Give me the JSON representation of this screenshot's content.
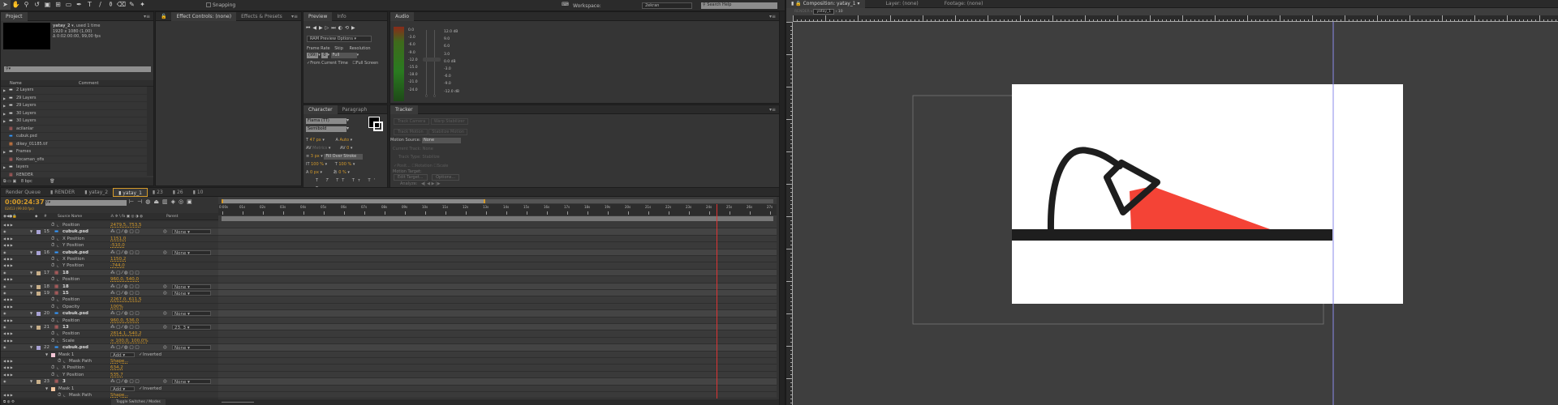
{
  "toolbar": {
    "snapping_label": "Snapping",
    "workspace_label": "Workspace:",
    "workspace_value": "2ekran",
    "search_placeholder": "Search Help"
  },
  "project": {
    "tab": "Project",
    "comp_name": "yatay_2",
    "used": ", used 1 time",
    "dims": "1920 x 1080 (1,00)",
    "duration": "Δ 0:02:00:00, 99,00 fps",
    "col_name": "Name",
    "col_comment": "Comment",
    "items": [
      {
        "type": "folder",
        "name": "2 Layers"
      },
      {
        "type": "folder",
        "name": "29 Layers"
      },
      {
        "type": "folder",
        "name": "29 Layers"
      },
      {
        "type": "folder",
        "name": "30 Layers"
      },
      {
        "type": "folder",
        "name": "30 Layers"
      },
      {
        "type": "comp",
        "name": "acilanlar"
      },
      {
        "type": "psd",
        "name": "cubuk.psd"
      },
      {
        "type": "tif",
        "name": "dikey_01185.tif"
      },
      {
        "type": "folder",
        "name": "Frames"
      },
      {
        "type": "comp",
        "name": "Kocaman_ofis"
      },
      {
        "type": "folder",
        "name": "layers"
      },
      {
        "type": "comp",
        "name": "RENDER"
      }
    ],
    "bpc": "8 bpc"
  },
  "effects": {
    "tab1": "Effect Controls: (none)",
    "tab2": "Effects & Presets"
  },
  "preview": {
    "tab1": "Preview",
    "tab2": "Info",
    "ram": "RAM Preview Options",
    "frame_rate_label": "Frame Rate",
    "skip_label": "Skip",
    "resolution_label": "Resolution",
    "frame_rate": "(99)",
    "skip": "0",
    "resolution": "Full",
    "from_current": "From Current Time",
    "full_screen": "Full Screen"
  },
  "audio": {
    "tab": "Audio",
    "meter_labels": [
      "0.0",
      "-3.0",
      "-6.0",
      "-9.0",
      "-12.0",
      "-15.0",
      "-18.0",
      "-21.0",
      "-24.0"
    ],
    "gain_labels": [
      "12.0 dB",
      "9.0",
      "6.0",
      "3.0",
      "0.0 dB",
      "-3.0",
      "-6.0",
      "-9.0",
      "-12.0 dB"
    ],
    "slider_l": "0",
    "slider_r": "0"
  },
  "character": {
    "tab1": "Character",
    "tab2": "Paragraph",
    "font": "Flama (TT)",
    "style": "Semibold",
    "size": "47 px",
    "leading": "Auto",
    "kerning": "Metrics",
    "tracking": "0",
    "stroke": "3 px",
    "stroke_mode": "Fill Over Stroke",
    "vscale": "100 %",
    "hscale": "100 %",
    "baseline": "0 px",
    "tsume": "0 %"
  },
  "tracker": {
    "tab": "Tracker",
    "track_camera": "Track Camera",
    "warp": "Warp Stabilizer",
    "track_motion": "Track Motion",
    "stabilize": "Stabilize Motion",
    "motion_source_label": "Motion Source:",
    "motion_source": "None",
    "current_track_label": "Current Track:",
    "current_track": "None",
    "track_type_label": "Track Type:",
    "track_type": "Stabilize",
    "position": "Posit...",
    "rotation": "Rotation",
    "scale": "Scale",
    "motion_target": "Motion Target:",
    "edit_target": "Edit Target...",
    "options": "Options...",
    "analyze": "Analyze:"
  },
  "timeline": {
    "tabs": [
      "Render Queue",
      "RENDER",
      "yatay_2",
      "yatay_1",
      "23",
      "26",
      "10"
    ],
    "active_tab": 3,
    "time": "0:00:24:37",
    "frame": "02413 (99.00 fps)",
    "col_source": "Source Name",
    "col_parent": "Parent",
    "ruler": [
      "0:00s",
      "01s",
      "02s",
      "03s",
      "04s",
      "05s",
      "06s",
      "07s",
      "08s",
      "09s",
      "10s",
      "11s",
      "12s",
      "13s",
      "14s",
      "15s",
      "16s",
      "17s",
      "18s",
      "19s",
      "20s",
      "21s",
      "22s",
      "23s",
      "24s",
      "25s",
      "26s",
      "27s"
    ],
    "current_seconds": 24.37,
    "work_area_end_seconds": 13,
    "toggle_label": "Toggle Switches / Modes",
    "rows": [
      {
        "k": "prop",
        "name": "Position",
        "value": "2479,5, 753,5"
      },
      {
        "k": "layer",
        "num": "15",
        "name": "cubuk.psd",
        "icon": "psd",
        "color": "#a9a3d6",
        "parent": "None"
      },
      {
        "k": "prop",
        "name": "X Position",
        "value": "1151,0"
      },
      {
        "k": "prop",
        "name": "Y Position",
        "value": "-510,0"
      },
      {
        "k": "layer",
        "num": "16",
        "name": "cubuk.psd",
        "icon": "psd",
        "color": "#a9a3d6",
        "parent": "None"
      },
      {
        "k": "prop",
        "name": "X Position",
        "value": "1150,2"
      },
      {
        "k": "prop",
        "name": "Y Position",
        "value": "-744,0"
      },
      {
        "k": "layer",
        "num": "17",
        "name": "18",
        "icon": "comp",
        "color": "#c9b08a",
        "parent": ""
      },
      {
        "k": "prop",
        "name": "Position",
        "value": "960,0, 540,0"
      },
      {
        "k": "layer",
        "num": "18",
        "name": "18",
        "icon": "comp",
        "color": "#c9b08a",
        "parent": "None"
      },
      {
        "k": "layer",
        "num": "19",
        "name": "15",
        "icon": "comp",
        "color": "#c9b08a",
        "parent": "None"
      },
      {
        "k": "prop",
        "name": "Position",
        "value": "2267,0, 611,5"
      },
      {
        "k": "prop",
        "name": "Opacity",
        "value": "100%"
      },
      {
        "k": "layer",
        "num": "20",
        "name": "cubuk.psd",
        "icon": "psd",
        "color": "#a9a3d6",
        "parent": "None"
      },
      {
        "k": "prop",
        "name": "Position",
        "value": "960,0, 536,0"
      },
      {
        "k": "layer",
        "num": "21",
        "name": "13",
        "icon": "comp",
        "color": "#c9b08a",
        "parent": "23. 3"
      },
      {
        "k": "prop",
        "name": "Position",
        "value": "2814,1, 540,2"
      },
      {
        "k": "prop",
        "name": "Scale",
        "value": "∞ 100,0, 100,0%"
      },
      {
        "k": "layer",
        "num": "22",
        "name": "cubuk.psd",
        "icon": "psd",
        "color": "#a9a3d6",
        "parent": "None"
      },
      {
        "k": "mask",
        "name": "Mask 1",
        "mode": "Add",
        "inverted": "Inverted",
        "color": "#f3c6d6"
      },
      {
        "k": "prop",
        "name": "Mask Path",
        "value": "Shape...",
        "indent": true
      },
      {
        "k": "prop",
        "name": "X Position",
        "value": "634,2"
      },
      {
        "k": "prop",
        "name": "Y Position",
        "value": "535,7"
      },
      {
        "k": "layer",
        "num": "23",
        "name": "3",
        "icon": "comp",
        "color": "#c9b08a",
        "parent": "None"
      },
      {
        "k": "mask",
        "name": "Mask 1",
        "mode": "Add",
        "inverted": "Inverted",
        "color": "#f3c6a0"
      },
      {
        "k": "prop",
        "name": "Mask Path",
        "value": "Shape...",
        "indent": true
      }
    ]
  },
  "composition": {
    "tab": "Composition: yatay_1",
    "layer_tab": "Layer: (none)",
    "footage_tab": "Footage: (none)",
    "crumbs": [
      "RENDER",
      "yatay_1",
      "10"
    ],
    "colors": {
      "beam": "#f44336",
      "ink": "#1e1e1e",
      "frame": "#ffffff"
    }
  }
}
